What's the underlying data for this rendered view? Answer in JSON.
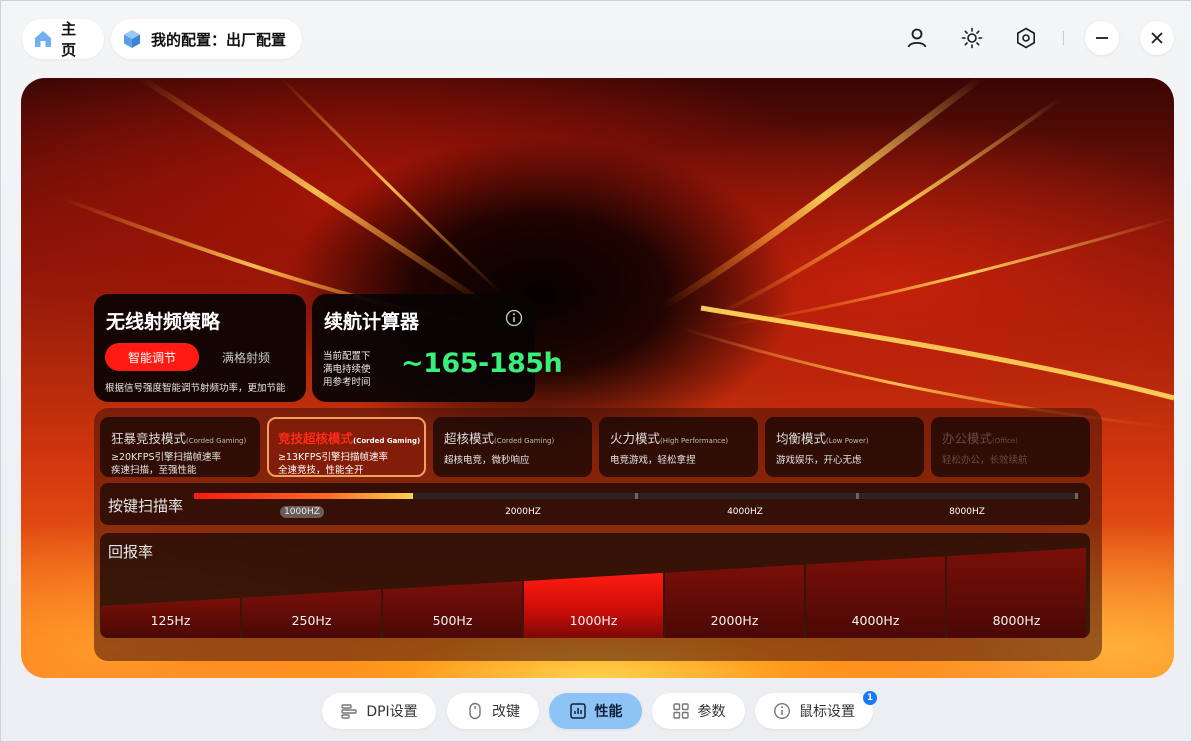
{
  "header": {
    "home_label": "主页",
    "config_label": "我的配置：出厂配置",
    "icons": [
      "home-icon",
      "cube-icon",
      "user-icon",
      "brightness-icon",
      "settings-hex-icon",
      "minimize-icon",
      "close-icon"
    ]
  },
  "rf_strategy": {
    "title": "无线射频策略",
    "options": [
      "智能调节",
      "满格射频"
    ],
    "selected": "智能调节",
    "description": "根据信号强度智能调节射频功率，更加节能"
  },
  "battery": {
    "title": "续航计算器",
    "desc_lines": [
      "当前配置下",
      "满电持续使",
      "用参考时间"
    ],
    "value": "~165-185h"
  },
  "modes": [
    {
      "name": "狂暴竞技模式",
      "tag": "(Corded Gaming)",
      "desc1": "≥20KFPS引擎扫描帧速率",
      "desc2": "疾速扫描，至强性能",
      "state": "normal"
    },
    {
      "name": "竞技超核模式",
      "tag": "(Corded Gaming)",
      "desc1": "≥13KFPS引擎扫描帧速率",
      "desc2": "全速竞技，性能全开",
      "state": "active"
    },
    {
      "name": "超核模式",
      "tag": "(Corded Gaming)",
      "desc1": "超核电竞，微秒响应",
      "desc2": "",
      "state": "normal"
    },
    {
      "name": "火力模式",
      "tag": "(High Performance)",
      "desc1": "电竞游戏，轻松拿捏",
      "desc2": "",
      "state": "normal"
    },
    {
      "name": "均衡模式",
      "tag": "(Low Power)",
      "desc1": "游戏娱乐，开心无虑",
      "desc2": "",
      "state": "normal"
    },
    {
      "name": "办公模式",
      "tag": "(Office)",
      "desc1": "轻松办公，长效续航",
      "desc2": "",
      "state": "dim"
    }
  ],
  "scan_rate": {
    "label": "按键扫描率",
    "ticks": [
      "1000HZ",
      "2000HZ",
      "4000HZ",
      "8000HZ"
    ],
    "selected": "1000HZ",
    "fill_fraction": 0.25
  },
  "report_rate": {
    "label": "回报率",
    "options": [
      "125Hz",
      "250Hz",
      "500Hz",
      "1000Hz",
      "2000Hz",
      "4000Hz",
      "8000Hz"
    ],
    "selected": "1000Hz"
  },
  "bottom_nav": {
    "tabs": [
      {
        "label": "DPI设置",
        "icon": "dpi-icon"
      },
      {
        "label": "改键",
        "icon": "mouse-icon"
      },
      {
        "label": "性能",
        "icon": "performance-chart-icon"
      },
      {
        "label": "参数",
        "icon": "grid-icon"
      },
      {
        "label": "鼠标设置",
        "icon": "info-circle-icon"
      }
    ],
    "active": "性能",
    "badge_count": "1"
  },
  "colors": {
    "accent_red": "#ff1b12",
    "battery_green": "#39f07a",
    "active_tab": "#8ec3f5",
    "badge_blue": "#1677ff"
  }
}
